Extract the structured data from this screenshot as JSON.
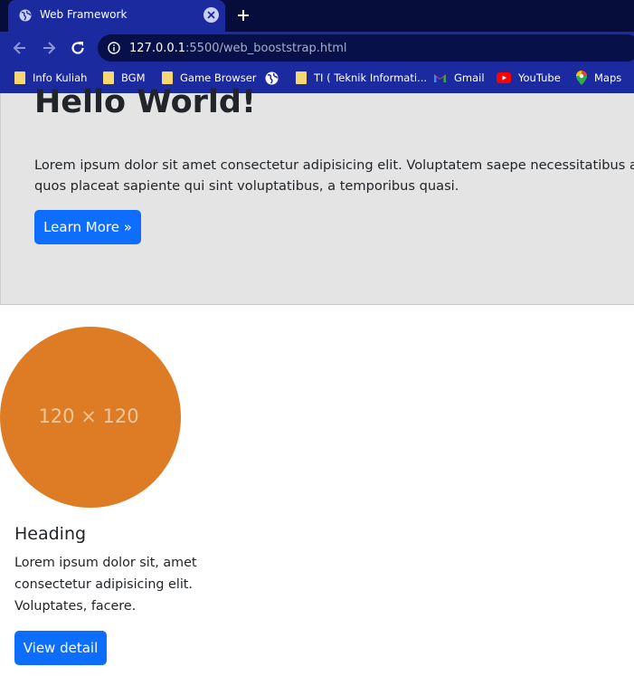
{
  "browser": {
    "tab_title": "Web Framework",
    "url_host": "127.0.0.1",
    "url_rest": ":5500/web_booststrap.html",
    "bookmarks": [
      {
        "label": "Info Kuliah",
        "icon": "folder-icon"
      },
      {
        "label": "BGM",
        "icon": "folder-icon"
      },
      {
        "label": "Game Browser",
        "icon": "folder-icon"
      },
      {
        "label": "",
        "icon": "globe-icon"
      },
      {
        "label": "TI ( Teknik Informati...",
        "icon": "folder-icon"
      },
      {
        "label": "Gmail",
        "icon": "gmail-icon"
      },
      {
        "label": "YouTube",
        "icon": "youtube-icon"
      },
      {
        "label": "Maps",
        "icon": "maps-icon"
      }
    ]
  },
  "hero": {
    "title": "Hello World!",
    "text_line1": "Lorem ipsum dolor sit amet consectetur adipisicing elit. Voluptatem saepe necessitatibus asperna",
    "text_line2": "quos placeat sapiente qui sint voluptatibus, a temporibus quasi.",
    "button_label": "Learn More »"
  },
  "card": {
    "placeholder_label": "120 × 120",
    "heading": "Heading",
    "text": "Lorem ipsum dolor sit, amet consectetur adipisicing elit. Voluptates, facere.",
    "button_label": "View detail"
  },
  "colors": {
    "primary": "#0d6efd",
    "placeholder": "#dd7c24",
    "jumbotron_bg": "#e4e4e4",
    "chrome_dark": "#070d3a",
    "chrome_blue": "#1b2a9e"
  }
}
